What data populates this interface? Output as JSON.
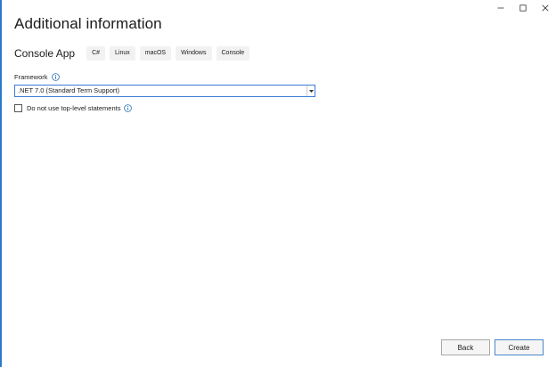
{
  "window": {
    "minimize_icon": "minimize-icon",
    "maximize_icon": "maximize-icon",
    "close_icon": "close-icon"
  },
  "header": {
    "title": "Additional information"
  },
  "template": {
    "name": "Console App",
    "tags": [
      "C#",
      "Linux",
      "macOS",
      "Windows",
      "Console"
    ]
  },
  "framework": {
    "label": "Framework",
    "selected": ".NET 7.0 (Standard Term Support)"
  },
  "options": {
    "top_level_statements_label": "Do not use top-level statements",
    "top_level_statements_checked": false
  },
  "footer": {
    "back_label": "Back",
    "create_label": "Create"
  },
  "colors": {
    "accent": "#3a7bd5",
    "info": "#1f6fb5"
  }
}
